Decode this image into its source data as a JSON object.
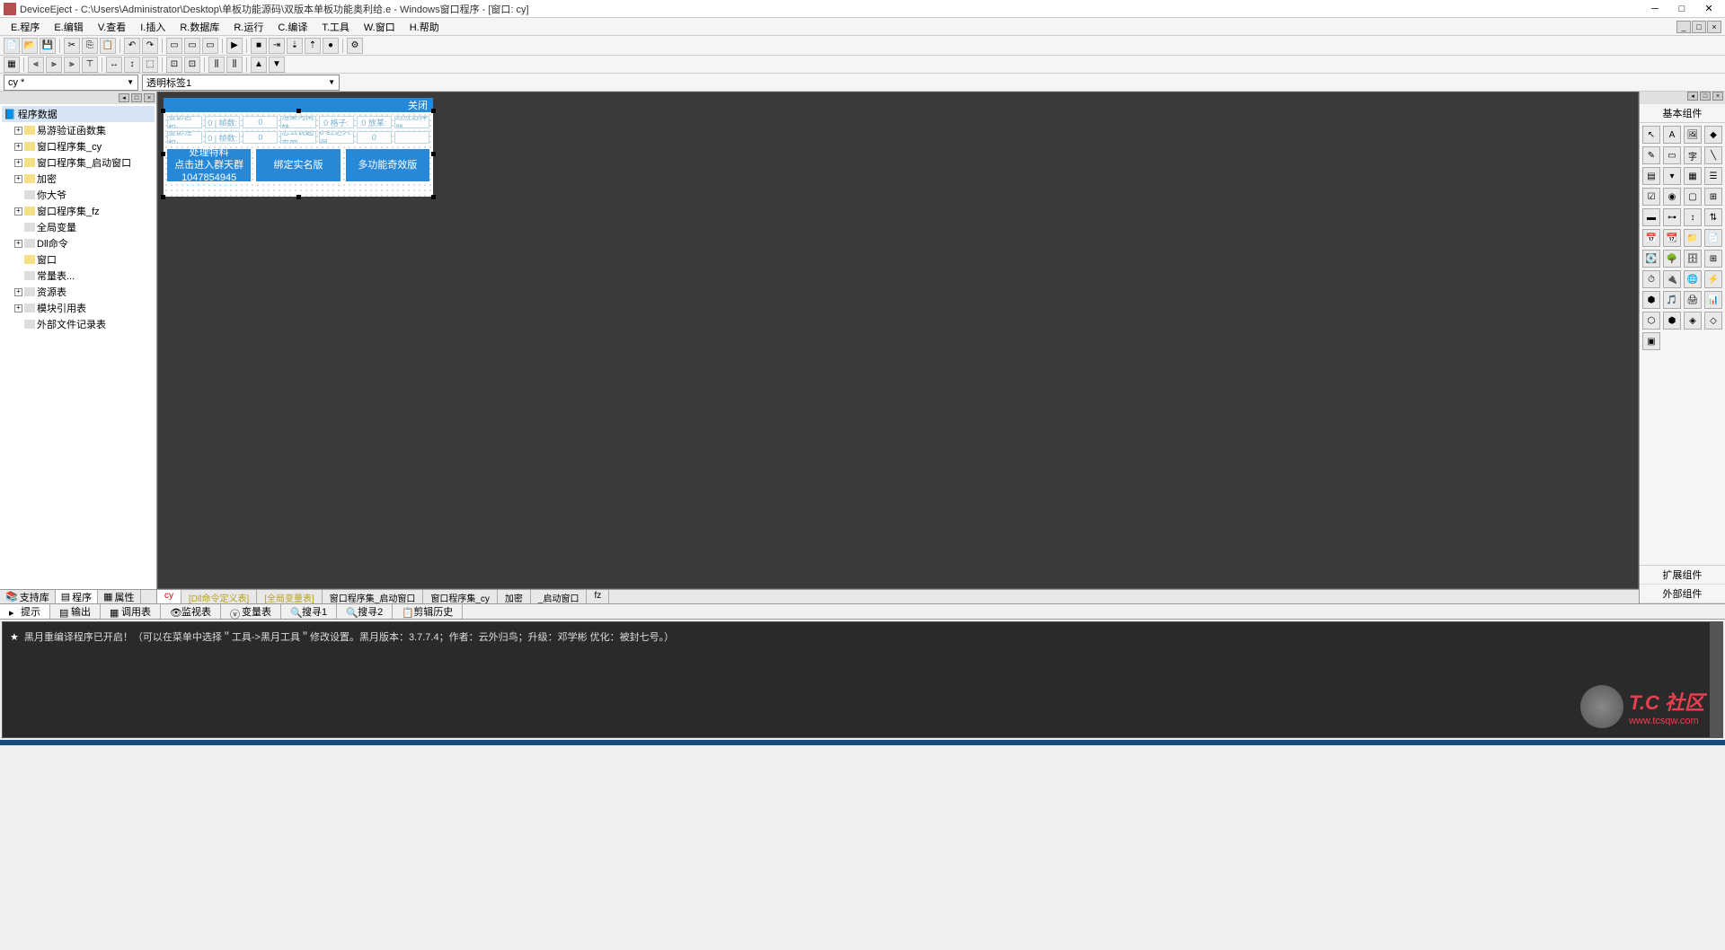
{
  "title": "DeviceEject - C:\\Users\\Administrator\\Desktop\\单板功能源码\\双版本单板功能奥利给.e - Windows窗口程序 - [窗口: cy]",
  "menu": {
    "program": "E.程序",
    "edit": "E.编辑",
    "view": "V.查看",
    "insert": "I.插入",
    "database": "R.数据库",
    "run": "R.运行",
    "compile": "C.编译",
    "tools": "T.工具",
    "window": "W.窗口",
    "help": "H.帮助"
  },
  "combo1": "cy *",
  "combo2": "透明标签1",
  "tree": {
    "root": "程序数据",
    "items": [
      {
        "label": "易游验证函数集",
        "indent": 1,
        "toggle": "+",
        "icon": "folder"
      },
      {
        "label": "窗口程序集_cy",
        "indent": 1,
        "toggle": "+",
        "icon": "folder"
      },
      {
        "label": "窗口程序集_启动窗口",
        "indent": 1,
        "toggle": "+",
        "icon": "folder"
      },
      {
        "label": "加密",
        "indent": 1,
        "toggle": "+",
        "icon": "folder"
      },
      {
        "label": "你大爷",
        "indent": 1,
        "toggle": "",
        "icon": "file"
      },
      {
        "label": "窗口程序集_fz",
        "indent": 1,
        "toggle": "+",
        "icon": "folder"
      },
      {
        "label": "全局变量",
        "indent": 1,
        "toggle": "",
        "icon": "file"
      },
      {
        "label": "Dll命令",
        "indent": 1,
        "toggle": "+",
        "icon": "file"
      },
      {
        "label": "窗口",
        "indent": 1,
        "toggle": "",
        "icon": "folder"
      },
      {
        "label": "常量表...",
        "indent": 1,
        "toggle": "",
        "icon": "file"
      },
      {
        "label": "资源表",
        "indent": 1,
        "toggle": "+",
        "icon": "file"
      },
      {
        "label": "模块引用表",
        "indent": 1,
        "toggle": "+",
        "icon": "file"
      },
      {
        "label": "外部文件记录表",
        "indent": 1,
        "toggle": "",
        "icon": "file"
      }
    ]
  },
  "form": {
    "close": "关闭",
    "row1": [
      "显影区权:",
      "0 | 帧数:",
      "0",
      "渲染河南韩",
      "0 格子:",
      "0 放某:",
      "适应选择器"
    ],
    "row2": [
      "显影注权:",
      "0 | 帧数:",
      "0",
      "怎么说起来吧",
      "0 红达入洞",
      "0",
      " ",
      ""
    ],
    "btn1_line1": "处理特料",
    "btn1_line2": "点击进入群天群",
    "btn1_line3": "1047854945",
    "btn2": "绑定实名版",
    "btn3": "多功能奇效版"
  },
  "right": {
    "title": "基本组件",
    "footer1": "扩展组件",
    "footer2": "外部组件"
  },
  "leftTabs": {
    "t1": "支持库",
    "t2": "程序",
    "t3": "属性"
  },
  "centerTabs": {
    "t1": "cy",
    "t2": "[Dll命令定义表]",
    "t3": "[全局变量表]",
    "t4": "窗口程序集_启动窗口",
    "t5": "窗口程序集_cy",
    "t6": "加密",
    "t7": "_启动窗口",
    "t8": "fz"
  },
  "bottomTabs": {
    "t1": "提示",
    "t2": "输出",
    "t3": "调用表",
    "t4": "监视表",
    "t5": "变量表",
    "t6": "搜寻1",
    "t7": "搜寻2",
    "t8": "剪辑历史"
  },
  "console": {
    "line1": "黑月重编译程序已开启！（可以在菜单中选择＂工具->黑月工具＂修改设置。黑月版本：3.7.7.4；作者：云外归鸟；升级：邓学彬 优化：被封七号。）"
  },
  "watermark": {
    "text1": "T.C 社区",
    "text2": "www.tcsqw.com"
  }
}
